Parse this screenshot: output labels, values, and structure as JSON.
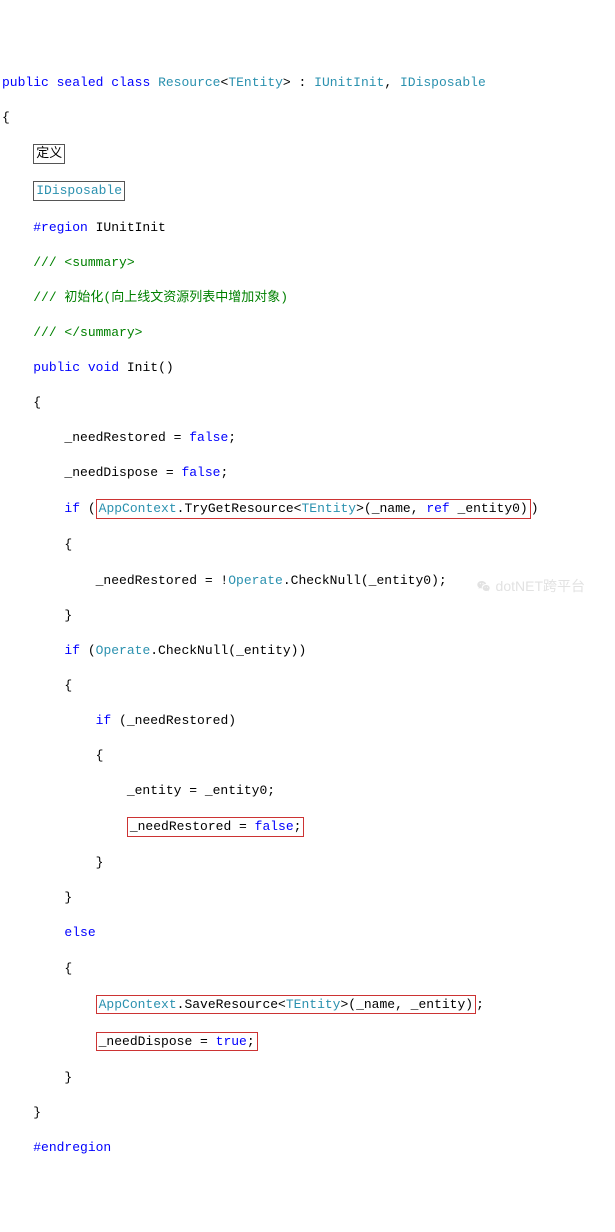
{
  "code": {
    "l1_public": "public",
    "l1_sealed": "sealed",
    "l1_class": "class",
    "l1_resource": "Resource",
    "l1_lt": "<",
    "l1_tentity": "TEntity",
    "l1_gt": ">",
    "l1_colon": " : ",
    "l1_iunitinit": "IUnitInit",
    "l1_comma": ", ",
    "l1_idisposable": "IDisposable",
    "l2": "{",
    "l3_box": "定义",
    "l4_box": "IDisposable",
    "l5_region": "#region",
    "l5_text": " IUnitInit",
    "l6": "/// <summary>",
    "l7a": "///",
    "l7b": " 初始化(向上线文资源列表中增加对象)",
    "l8": "/// </summary>",
    "l9_public": "public",
    "l9_void": "void",
    "l9_rest": " Init()",
    "l10": "    {",
    "l11": "        _needRestored = ",
    "l11_false": "false",
    "l11_semi": ";",
    "l12": "        _needDispose = ",
    "l12_false": "false",
    "l12_semi": ";",
    "l13_if": "if",
    "l13_open": " (",
    "l13_app": "AppContext",
    "l13_mid": ".TryGetResource<",
    "l13_tentity": "TEntity",
    "l13_rest": ">(_name, ",
    "l13_ref": "ref",
    "l13_end": " _entity0)",
    "l13_close": ")",
    "l14": "        {",
    "l15a": "            _needRestored = !",
    "l15_op": "Operate",
    "l15b": ".CheckNull(_entity0);",
    "l16": "        }",
    "l17_if": "if",
    "l17_open": " (",
    "l17_op": "Operate",
    "l17_rest": ".CheckNull(_entity))",
    "l18": "        {",
    "l19_if": "if",
    "l19_rest": " (_needRestored)",
    "l20": "            {",
    "l21": "                _entity = _entity0;",
    "l22_box": "_needRestored = ",
    "l22_false": "false",
    "l22_semi": ";",
    "l23": "            }",
    "l24": "        }",
    "l25_else": "else",
    "l26": "        {",
    "l27_app": "AppContext",
    "l27_mid": ".SaveResource<",
    "l27_tentity": "TEntity",
    "l27_rest": ">(_name, _entity)",
    "l27_semi": ";",
    "l28_box": "_needDispose = ",
    "l28_true": "true",
    "l28_semi": ";",
    "l29": "        }",
    "l30": "    }",
    "l31": "#endregion"
  },
  "watermark": "dotNET跨平台"
}
